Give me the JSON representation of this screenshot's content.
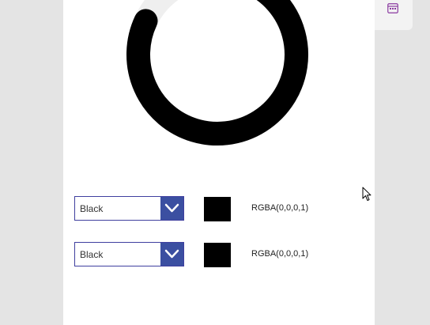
{
  "colors": {
    "ring_track": "#efefef",
    "ring_fill": "#000000",
    "dropdown_border": "#3f3f9f",
    "dropdown_button": "#3b4fa1",
    "swatch": "#000000"
  },
  "progress": {
    "value_fraction": 0.82
  },
  "rows": [
    {
      "dropdown": {
        "selected": "Black"
      },
      "swatch_color": "#000000",
      "rgba_text": "RGBA(0,0,0,1)"
    },
    {
      "dropdown": {
        "selected": "Black"
      },
      "swatch_color": "#000000",
      "rgba_text": "RGBA(0,0,0,1)"
    }
  ],
  "side_panel": {
    "icon": "calendar-icon"
  },
  "cursor": {
    "icon": "mouse-pointer-icon"
  }
}
